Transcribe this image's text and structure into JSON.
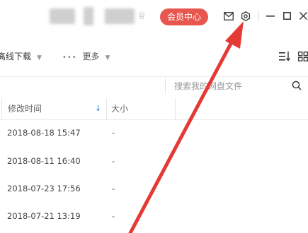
{
  "titlebar": {
    "member_label": "会员中心",
    "icons": [
      "vip-icon",
      "mail-icon",
      "settings-icon",
      "minimize-icon",
      "maximize-icon",
      "close-icon"
    ]
  },
  "toolbar": {
    "offline_download_label": "离线下载",
    "more_label": "更多",
    "more_prefix": "•••",
    "sort_icon": "sort-icon",
    "grid_icon": "grid-view-icon"
  },
  "search": {
    "placeholder": "搜索我的网盘文件",
    "icon": "search-icon"
  },
  "table": {
    "columns": {
      "modified": "修改时间",
      "size": "大小"
    },
    "rows": [
      {
        "modified": "2018-08-18 15:47",
        "size": "-"
      },
      {
        "modified": "2018-08-11 16:40",
        "size": "-"
      },
      {
        "modified": "2018-07-23 17:56",
        "size": "-"
      },
      {
        "modified": "2018-07-21 13:19",
        "size": "-"
      }
    ]
  },
  "annotation": {
    "color": "#e53935"
  },
  "colors": {
    "accent": "#e8574f",
    "sort_arrow": "#2b7de9"
  }
}
